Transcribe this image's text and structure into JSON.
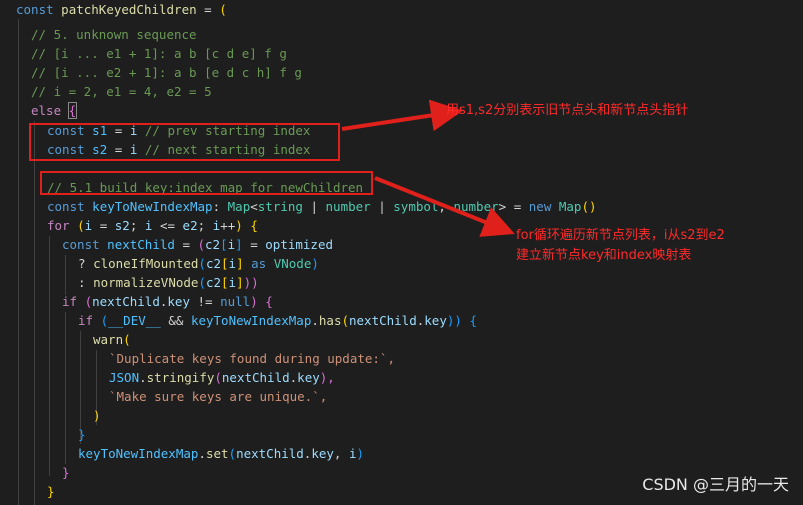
{
  "code": {
    "l1": [
      "const",
      "patchKeyedChildren",
      "=",
      "("
    ],
    "l2": "// 5. unknown sequence",
    "l3": "// [i ... e1 + 1]: a b [c d e] f g",
    "l4": "// [i ... e2 + 1]: a b [e d c h] f g",
    "l5": "// i = 2, e1 = 4, e2 = 5",
    "l6": [
      "else",
      "{"
    ],
    "l7": [
      "const",
      "s1",
      "=",
      "i",
      "// prev starting index"
    ],
    "l8": [
      "const",
      "s2",
      "=",
      "i",
      "// next starting index"
    ],
    "l10": "// 5.1 build key:index map for newChildren",
    "l11": [
      "const",
      "keyToNewIndexMap",
      ":",
      "Map",
      "<",
      "string",
      "|",
      "number",
      "|",
      "symbol",
      ",",
      "number",
      ">",
      "=",
      "new",
      "Map",
      "()"
    ],
    "l12": [
      "for",
      "(",
      "i",
      "=",
      "s2",
      ";",
      "i",
      "<=",
      "e2",
      ";",
      "i",
      "++",
      ")",
      "{"
    ],
    "l13": [
      "const",
      "nextChild",
      "=",
      "(",
      "c2",
      "[",
      "i",
      "]",
      "=",
      "optimized"
    ],
    "l14": [
      "?",
      "cloneIfMounted",
      "(",
      "c2",
      "[",
      "i",
      "]",
      "as",
      "VNode",
      ")"
    ],
    "l15": [
      ":",
      "normalizeVNode",
      "(",
      "c2",
      "[",
      "i",
      "]",
      "))"
    ],
    "l16": [
      "if",
      "(",
      "nextChild",
      ".",
      "key",
      "!=",
      "null",
      ")",
      "{"
    ],
    "l17": [
      "if",
      "(",
      "__DEV__",
      "&&",
      "keyToNewIndexMap",
      ".",
      "has",
      "(",
      "nextChild",
      ".",
      "key",
      "))",
      "{"
    ],
    "l18": [
      "warn",
      "("
    ],
    "l19": "`Duplicate keys found during update:`,",
    "l20": [
      "JSON",
      ".",
      "stringify",
      "(",
      "nextChild",
      ".",
      "key",
      "),"
    ],
    "l21": "`Make sure keys are unique.`,",
    "l22": ")",
    "l23": "}",
    "l24": [
      "keyToNewIndexMap",
      ".",
      "set",
      "(",
      "nextChild",
      ".",
      "key",
      ",",
      "i",
      ")"
    ],
    "l25": "}",
    "l26": "}"
  },
  "annotations": {
    "note1": "用s1,s2分别表示旧节点头和新节点头指针",
    "note2_line1": "for循环遍历新节点列表，i从s2到e2",
    "note2_line2": "建立新节点key和index映射表",
    "arrow_color": "#e0201b"
  },
  "watermark": "CSDN @三月的一天",
  "colors": {
    "background": "#1e1e1e",
    "keyword": "#569cd6",
    "control": "#c586c0",
    "variable": "#9cdcfe",
    "constant": "#4fc1ff",
    "function": "#dcdcaa",
    "type": "#4ec9b0",
    "string": "#ce9178",
    "comment": "#6a9955",
    "annotation_red": "#ff2a2a"
  }
}
